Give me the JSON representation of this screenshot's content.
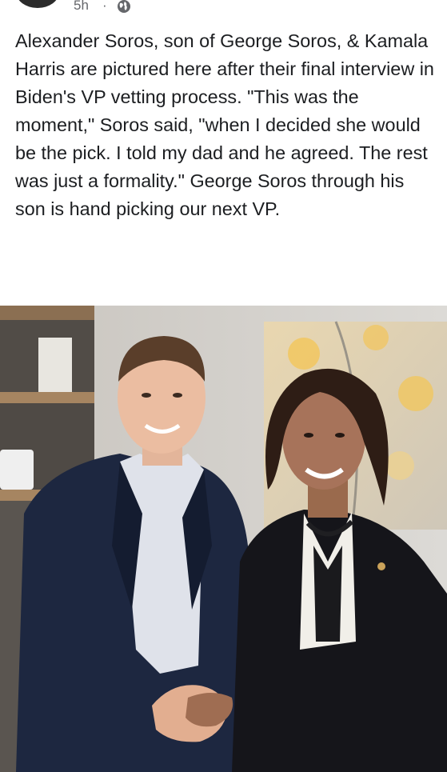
{
  "post": {
    "timestamp": "5h",
    "separator": "·",
    "privacy_icon": "globe-icon",
    "text": "Alexander Soros, son of George Soros, & Kamala Harris are pictured here after their final interview in Biden's VP vetting process. \"This was the moment,\" Soros said, \"when I decided she would be the pick. I told my dad and he agreed. The rest was just a formality.\" George Soros through his son is hand picking our next VP."
  },
  "photo": {
    "subject": "photo"
  },
  "colors": {
    "text": "#1c1e21",
    "meta": "#65676b",
    "background": "#ffffff"
  }
}
